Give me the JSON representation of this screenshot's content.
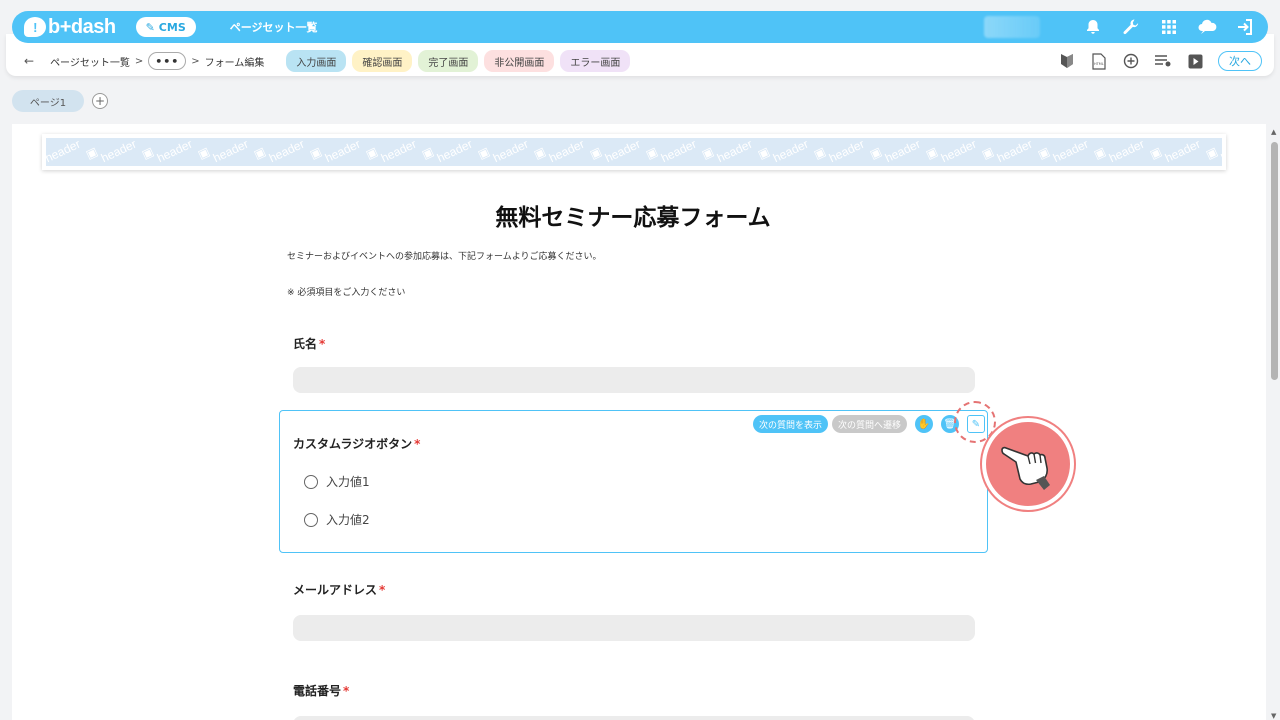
{
  "app": {
    "logo_text": "b+dash",
    "logo_mark": "!",
    "cms_label": "CMS",
    "page_title": "ページセット一覧",
    "icons": [
      "bell-icon",
      "wrench-icon",
      "grid-icon",
      "chat-cloud-icon",
      "logout-icon"
    ]
  },
  "breadcrumb": {
    "back": "←",
    "item1": "ページセット一覧",
    "sep": ">",
    "more": "•••",
    "item2": "フォーム編集"
  },
  "tabs": [
    {
      "label": "入力画面",
      "color": "#b9e3f3"
    },
    {
      "label": "確認画面",
      "color": "#fff2c6"
    },
    {
      "label": "完了画面",
      "color": "#e2f2d6"
    },
    {
      "label": "非公開画面",
      "color": "#fde0e0"
    },
    {
      "label": "エラー画面",
      "color": "#f0e2f7"
    }
  ],
  "tools": [
    "beginner-mark-icon",
    "html-file-icon",
    "add-circle-icon",
    "list-settings-icon",
    "play-icon"
  ],
  "next_label": "次へ",
  "page_tabs": {
    "page1": "ページ1",
    "add": "+"
  },
  "header_placeholder": {
    "word": "header"
  },
  "form": {
    "title": "無料セミナー応募フォーム",
    "description": "セミナーおよびイベントへの参加応募は、下記フォームよりご応募ください。",
    "note": "※ 必須項目をご入力ください",
    "required_mark": "*",
    "fields": {
      "name": {
        "label": "氏名"
      },
      "radio": {
        "label": "カスタムラジオボタン",
        "options": [
          "入力値1",
          "入力値2"
        ],
        "show_next_label": "次の質問を表示",
        "goto_next_label": "次の質問へ遷移"
      },
      "email": {
        "label": "メールアドレス"
      },
      "phone": {
        "label": "電話番号"
      }
    }
  },
  "colors": {
    "accent": "#4fc3f7",
    "required": "#e53935",
    "pointer": "#f08080"
  }
}
